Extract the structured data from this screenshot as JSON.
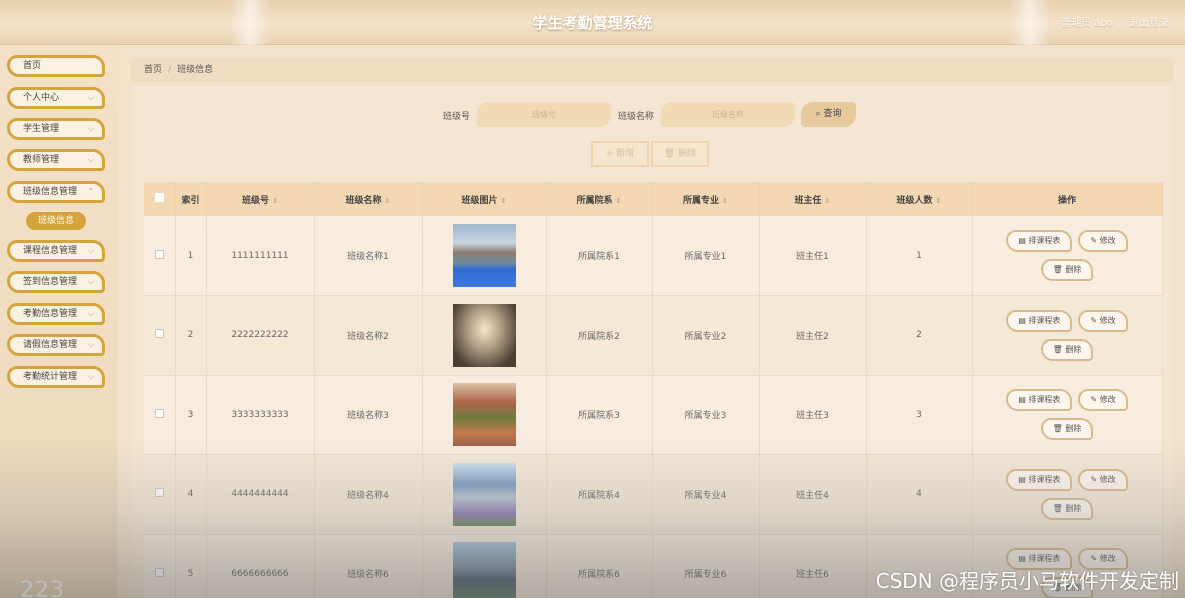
{
  "header": {
    "title": "学生考勤管理系统",
    "user": "管理员 abo",
    "logout": "退出登录"
  },
  "sidebar": {
    "items": [
      {
        "label": "首页",
        "chevron": false
      },
      {
        "label": "个人中心",
        "chevron": true
      },
      {
        "label": "学生管理",
        "chevron": true
      },
      {
        "label": "教师管理",
        "chevron": true
      },
      {
        "label": "班级信息管理",
        "chevron": true
      },
      {
        "label": "课程信息管理",
        "chevron": true
      },
      {
        "label": "签到信息管理",
        "chevron": true
      },
      {
        "label": "考勤信息管理",
        "chevron": true
      },
      {
        "label": "请假信息管理",
        "chevron": true
      },
      {
        "label": "考勤统计管理",
        "chevron": true
      }
    ],
    "active_sub": "班级信息",
    "bottom_text": "223"
  },
  "breadcrumb": {
    "home": "首页",
    "current": "班级信息"
  },
  "search": {
    "class_no_label": "班级号",
    "class_no_placeholder": "班级号",
    "class_name_label": "班级名称",
    "class_name_placeholder": "班级名称",
    "query": "查询"
  },
  "toolbar": {
    "add": "新增",
    "delete": "删除"
  },
  "table": {
    "headers": [
      "索引",
      "班级号",
      "班级名称",
      "班级图片",
      "所属院系",
      "所属专业",
      "班主任",
      "班级人数",
      "操作"
    ],
    "rows": [
      {
        "index": "1",
        "no": "1111111111",
        "name": "班级名称1",
        "dept": "所属院系1",
        "major": "所属专业1",
        "teacher": "班主任1",
        "count": "1"
      },
      {
        "index": "2",
        "no": "2222222222",
        "name": "班级名称2",
        "dept": "所属院系2",
        "major": "所属专业2",
        "teacher": "班主任2",
        "count": "2"
      },
      {
        "index": "3",
        "no": "3333333333",
        "name": "班级名称3",
        "dept": "所属院系3",
        "major": "所属专业3",
        "teacher": "班主任3",
        "count": "3"
      },
      {
        "index": "4",
        "no": "4444444444",
        "name": "班级名称4",
        "dept": "所属院系4",
        "major": "所属专业4",
        "teacher": "班主任4",
        "count": "4"
      },
      {
        "index": "5",
        "no": "6666666666",
        "name": "班级名称6",
        "dept": "所属院系6",
        "major": "所属专业6",
        "teacher": "班主任6",
        "count": ""
      }
    ],
    "ops": {
      "schedule": "排课程表",
      "edit": "修改",
      "delete": "删除"
    }
  },
  "watermark": "CSDN @程序员小马软件开发定制",
  "colors": {
    "accent": "#d4a53c",
    "header_bg": "#f0dcc0"
  }
}
